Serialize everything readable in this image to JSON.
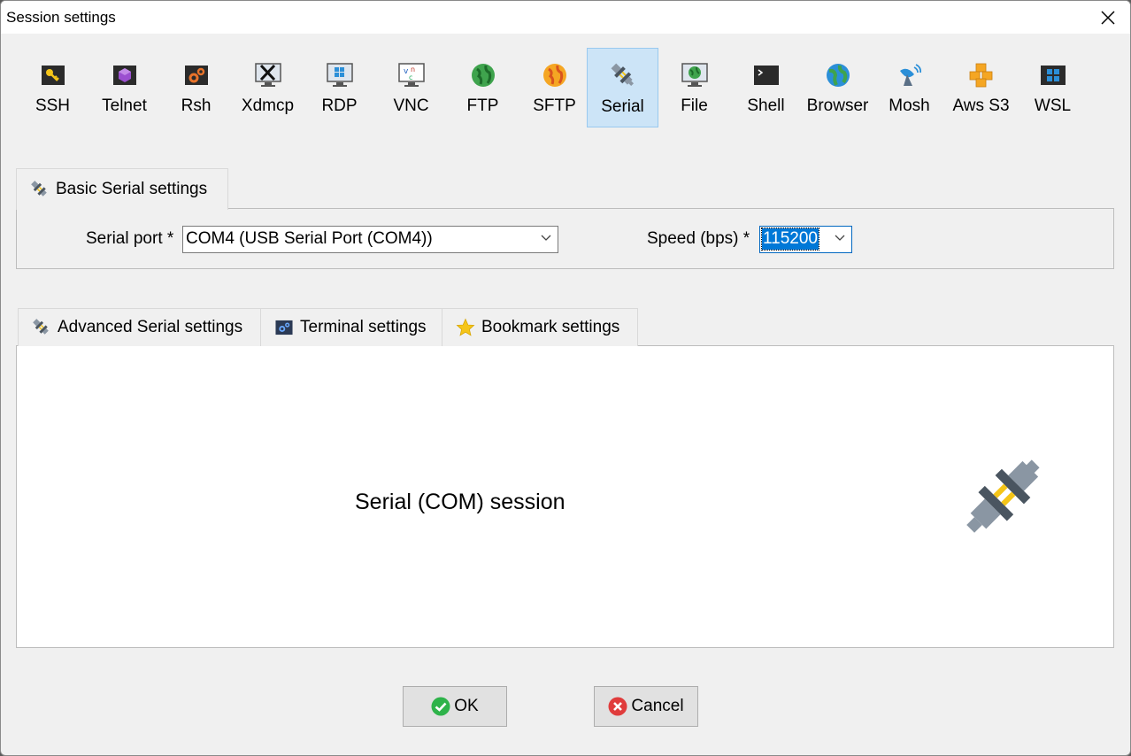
{
  "window": {
    "title": "Session settings"
  },
  "toolbar": {
    "items": [
      {
        "label": "SSH",
        "icon": "ssh-key-icon"
      },
      {
        "label": "Telnet",
        "icon": "telnet-icon"
      },
      {
        "label": "Rsh",
        "icon": "rsh-icon"
      },
      {
        "label": "Xdmcp",
        "icon": "xdmcp-icon"
      },
      {
        "label": "RDP",
        "icon": "rdp-icon"
      },
      {
        "label": "VNC",
        "icon": "vnc-icon"
      },
      {
        "label": "FTP",
        "icon": "ftp-globe-icon"
      },
      {
        "label": "SFTP",
        "icon": "sftp-globe-icon"
      },
      {
        "label": "Serial",
        "icon": "serial-plug-icon",
        "selected": true
      },
      {
        "label": "File",
        "icon": "file-monitor-icon"
      },
      {
        "label": "Shell",
        "icon": "shell-terminal-icon"
      },
      {
        "label": "Browser",
        "icon": "browser-globe-icon"
      },
      {
        "label": "Mosh",
        "icon": "mosh-satellite-icon"
      },
      {
        "label": "Aws S3",
        "icon": "aws-s3-icon"
      },
      {
        "label": "WSL",
        "icon": "wsl-windows-icon"
      }
    ]
  },
  "basic": {
    "tab_label": "Basic Serial settings",
    "serial_port_label": "Serial port *",
    "serial_port_value": "COM4  (USB Serial Port (COM4))",
    "speed_label": "Speed (bps) *",
    "speed_value": "115200"
  },
  "advanced_tabs": [
    {
      "label": "Advanced Serial settings",
      "icon": "serial-plug-icon"
    },
    {
      "label": "Terminal settings",
      "icon": "terminal-settings-icon"
    },
    {
      "label": "Bookmark settings",
      "icon": "star-icon"
    }
  ],
  "content": {
    "session_text": "Serial (COM) session"
  },
  "buttons": {
    "ok": "OK",
    "cancel": "Cancel"
  },
  "colors": {
    "selected_tool_bg": "#cce4f7",
    "selection_highlight": "#0078d7",
    "ok_green": "#2eb34a",
    "cancel_red": "#e03c3c"
  }
}
